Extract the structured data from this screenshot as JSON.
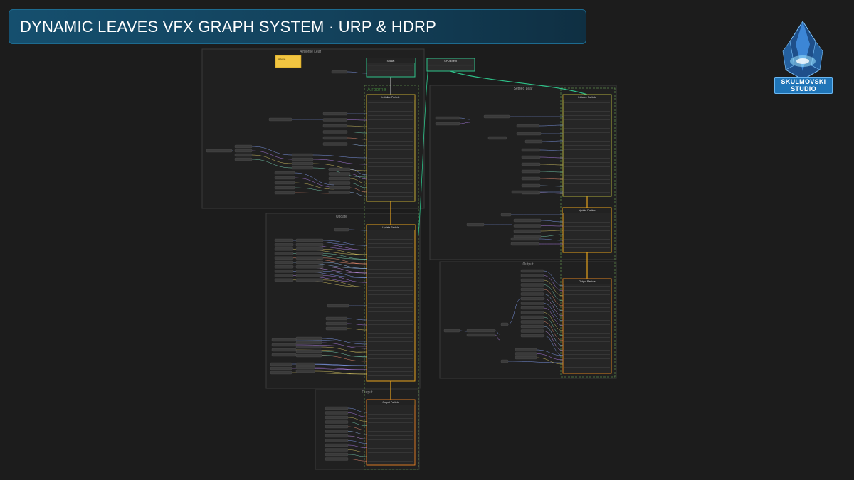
{
  "banner": {
    "title": "DYNAMIC LEAVES VFX GRAPH SYSTEM · URP & HDRP"
  },
  "graph": {
    "groups": {
      "airborne_leaf": "Airborne Leaf",
      "settled_leaf": "Settled Leaf",
      "update": "Update",
      "output_left": "Output",
      "output_right": "Output"
    },
    "systems": {
      "airborne": "Airborne"
    },
    "blocks": {
      "spawn": "Spawn",
      "initialize": "Initialize Particle",
      "update": "Update Particle",
      "output": "Output Particle",
      "event": "GPU Event"
    },
    "sticky_note": "Airborne"
  },
  "brand": {
    "line1": "SKULMOVSKI",
    "line2": "STUDIO"
  },
  "colors": {
    "accent_teal": "#2ec38a",
    "accent_orange": "#e6a21d",
    "output_red": "#c0392b",
    "banner": "#154f6e"
  }
}
